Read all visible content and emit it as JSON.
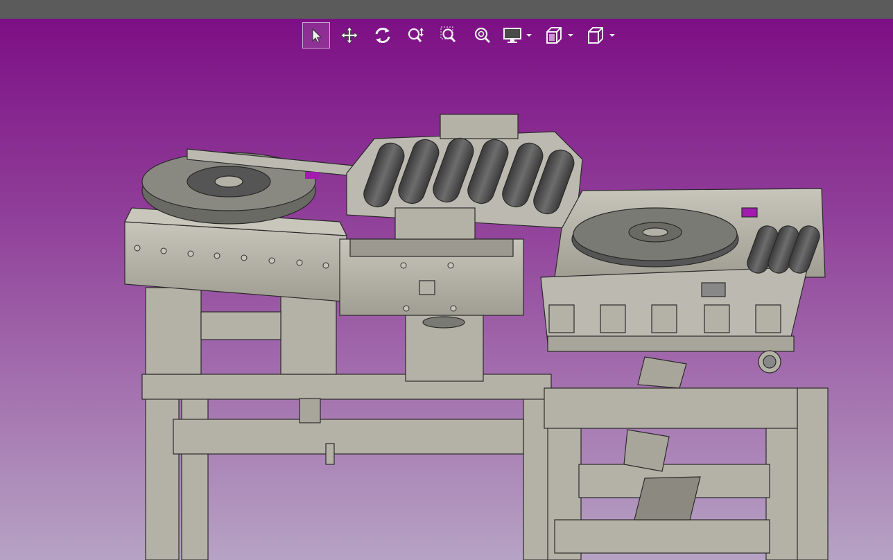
{
  "window": {
    "title": ""
  },
  "viewport": {
    "background_top": "#7d0f85",
    "background_bottom": "#b6a3c4"
  },
  "toolbar": {
    "tools": [
      {
        "name": "select-tool",
        "icon": "cursor-arrow-icon",
        "active": true
      },
      {
        "name": "pan-tool",
        "icon": "move-arrows-icon",
        "active": false
      },
      {
        "name": "rotate-tool",
        "icon": "rotate-icon",
        "active": false
      },
      {
        "name": "zoom-dynamic-tool",
        "icon": "zoom-updown-icon",
        "active": false
      },
      {
        "name": "zoom-window-tool",
        "icon": "zoom-window-icon",
        "active": false
      },
      {
        "name": "zoom-fit-tool",
        "icon": "zoom-fit-icon",
        "active": false
      },
      {
        "name": "display-mode-menu",
        "icon": "monitor-icon",
        "active": false,
        "dropdown": true
      },
      {
        "name": "section-view-menu",
        "icon": "section-cube-icon",
        "active": false,
        "dropdown": true
      },
      {
        "name": "view-orientation-menu",
        "icon": "box-view-icon",
        "active": false,
        "dropdown": true
      }
    ]
  },
  "model": {
    "part_color": "#b4b2a6",
    "roller_color": "#555555",
    "edge_color": "#2a2a2a",
    "marker_color": "#a21caf"
  }
}
